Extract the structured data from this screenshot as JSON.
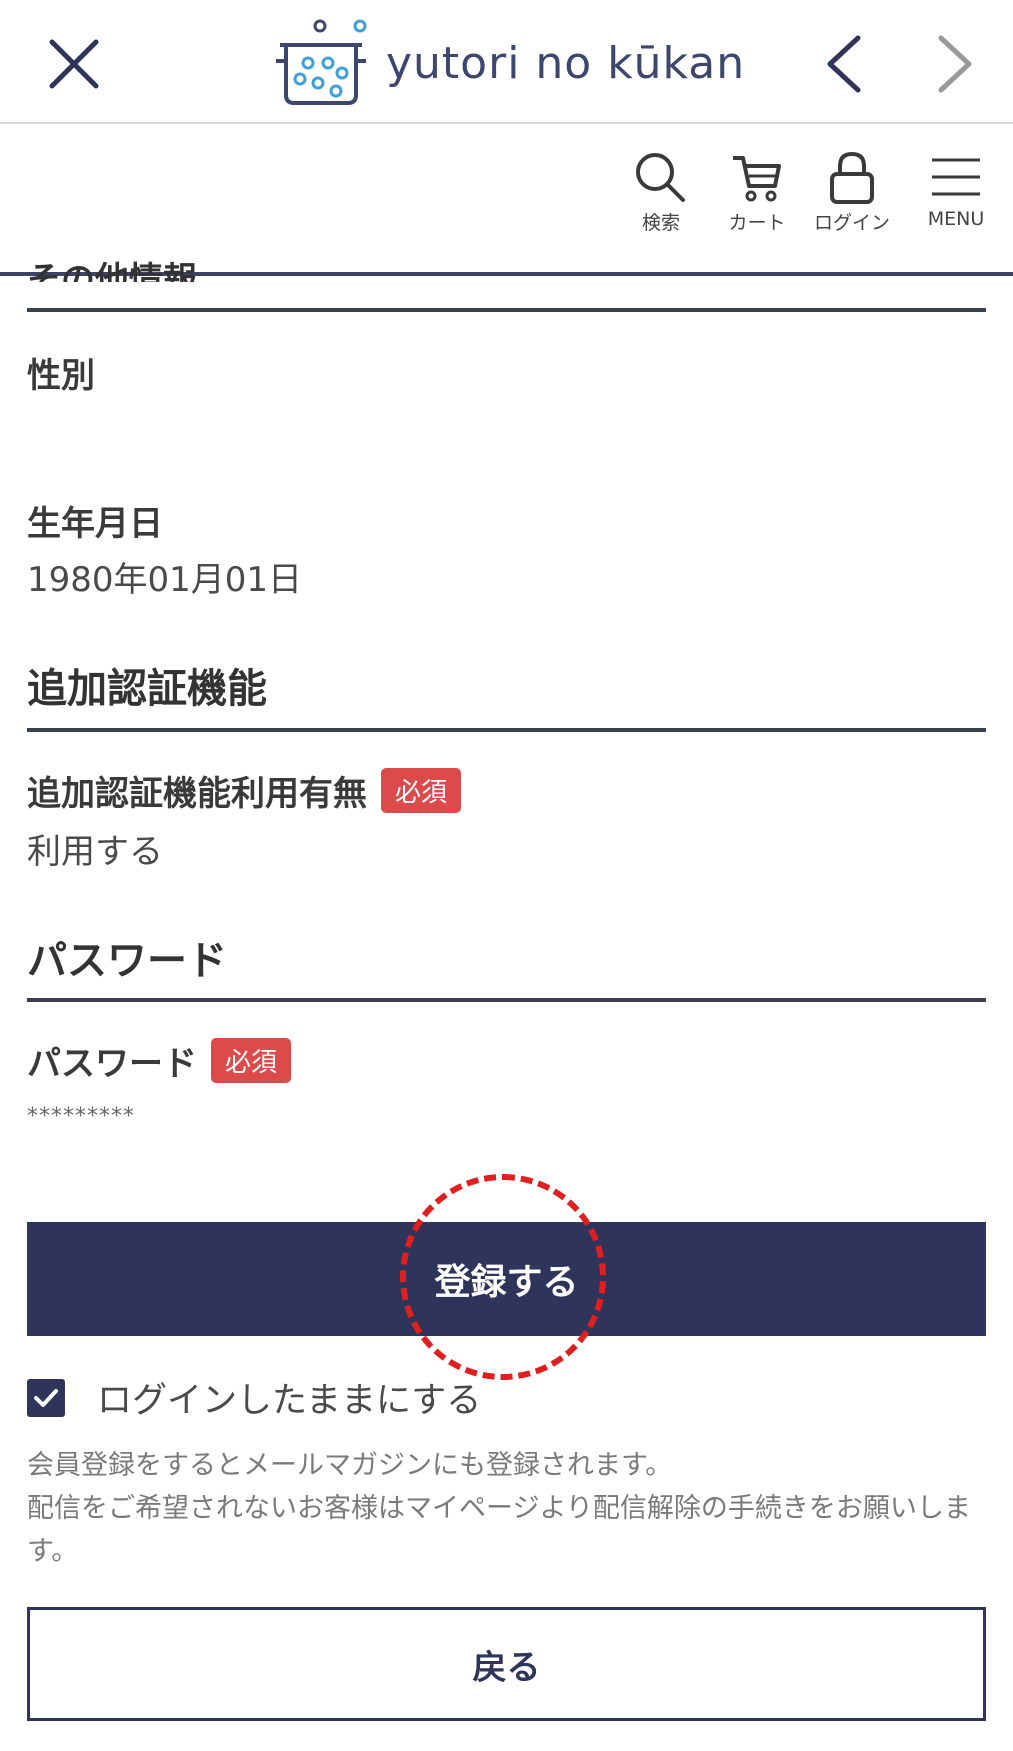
{
  "browser": {
    "brand_text": "yutori no kūkan",
    "icons": {
      "close": "close-icon",
      "back": "chevron-left-icon",
      "forward": "chevron-right-icon",
      "logo": "pot-logo-icon"
    }
  },
  "header": {
    "search_label": "検索",
    "cart_label": "カート",
    "login_label": "ログイン",
    "menu_label": "MENU"
  },
  "form": {
    "partial_section_heading": "その他情報",
    "gender": {
      "label": "性別",
      "value": ""
    },
    "birthdate": {
      "label": "生年月日",
      "value": "1980年01月01日"
    },
    "twofactor_section": "追加認証機能",
    "twofactor": {
      "label": "追加認証機能利用有無",
      "badge": "必須",
      "value": "利用する"
    },
    "password_section": "パスワード",
    "password": {
      "label": "パスワード",
      "badge": "必須",
      "value": "*********"
    },
    "submit_label": "登録する",
    "keep_login": {
      "checked": true,
      "label": "ログインしたままにする"
    },
    "notice_line1": "会員登録をするとメールマガジンにも登録されます。",
    "notice_line2": "配信をご希望されないお客様はマイページより配信解除の手続きをお願いします。",
    "back_label": "戻る"
  },
  "colors": {
    "navy": "#2e345a",
    "badge_red": "#dc4b4b",
    "highlight_red": "#e02020"
  }
}
